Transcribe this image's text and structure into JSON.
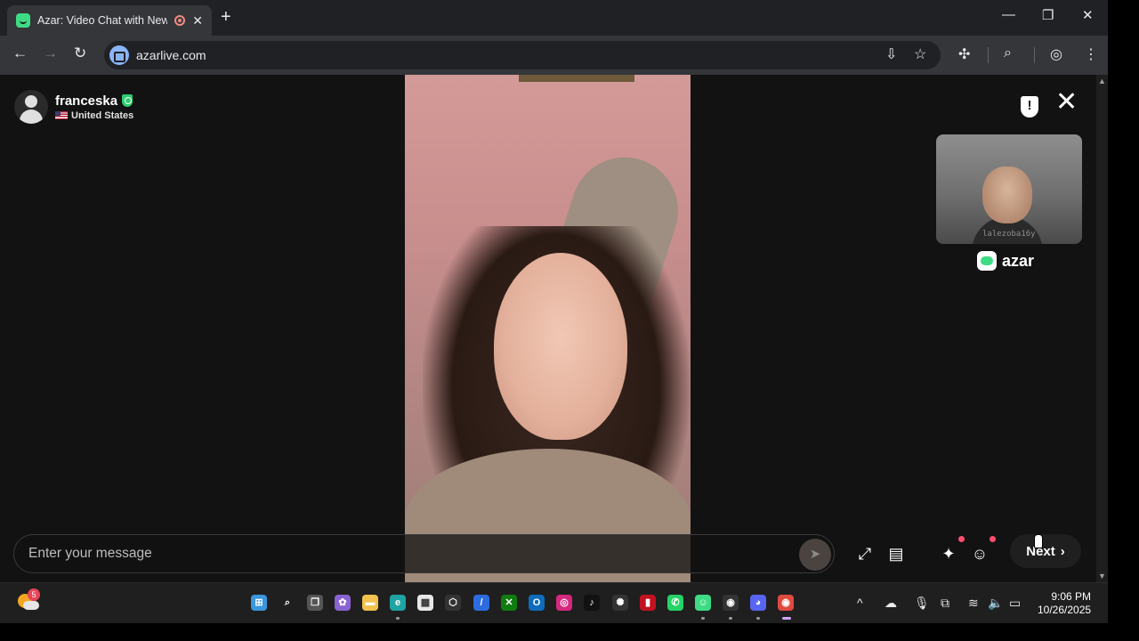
{
  "browser": {
    "tab_title": "Azar: Video Chat with New",
    "url": "azarlive.com",
    "new_tab_glyph": "+",
    "minimize_glyph": "—",
    "maximize_glyph": "❐",
    "close_glyph": "✕"
  },
  "profile": {
    "name": "franceska",
    "country": "United States"
  },
  "selfview": {
    "watermark": "lalezoba16y"
  },
  "brand": {
    "name": "azar"
  },
  "chat": {
    "placeholder": "Enter your message"
  },
  "controls": {
    "next_label": "Next",
    "next_chevron": "›"
  },
  "taskbar": {
    "weather_badge": "5",
    "time": "9:06 PM",
    "date": "10/26/2025"
  },
  "colors": {
    "accent_green": "#3ddc84",
    "notification_red": "#ff4d6d",
    "page_bg": "#121212"
  }
}
